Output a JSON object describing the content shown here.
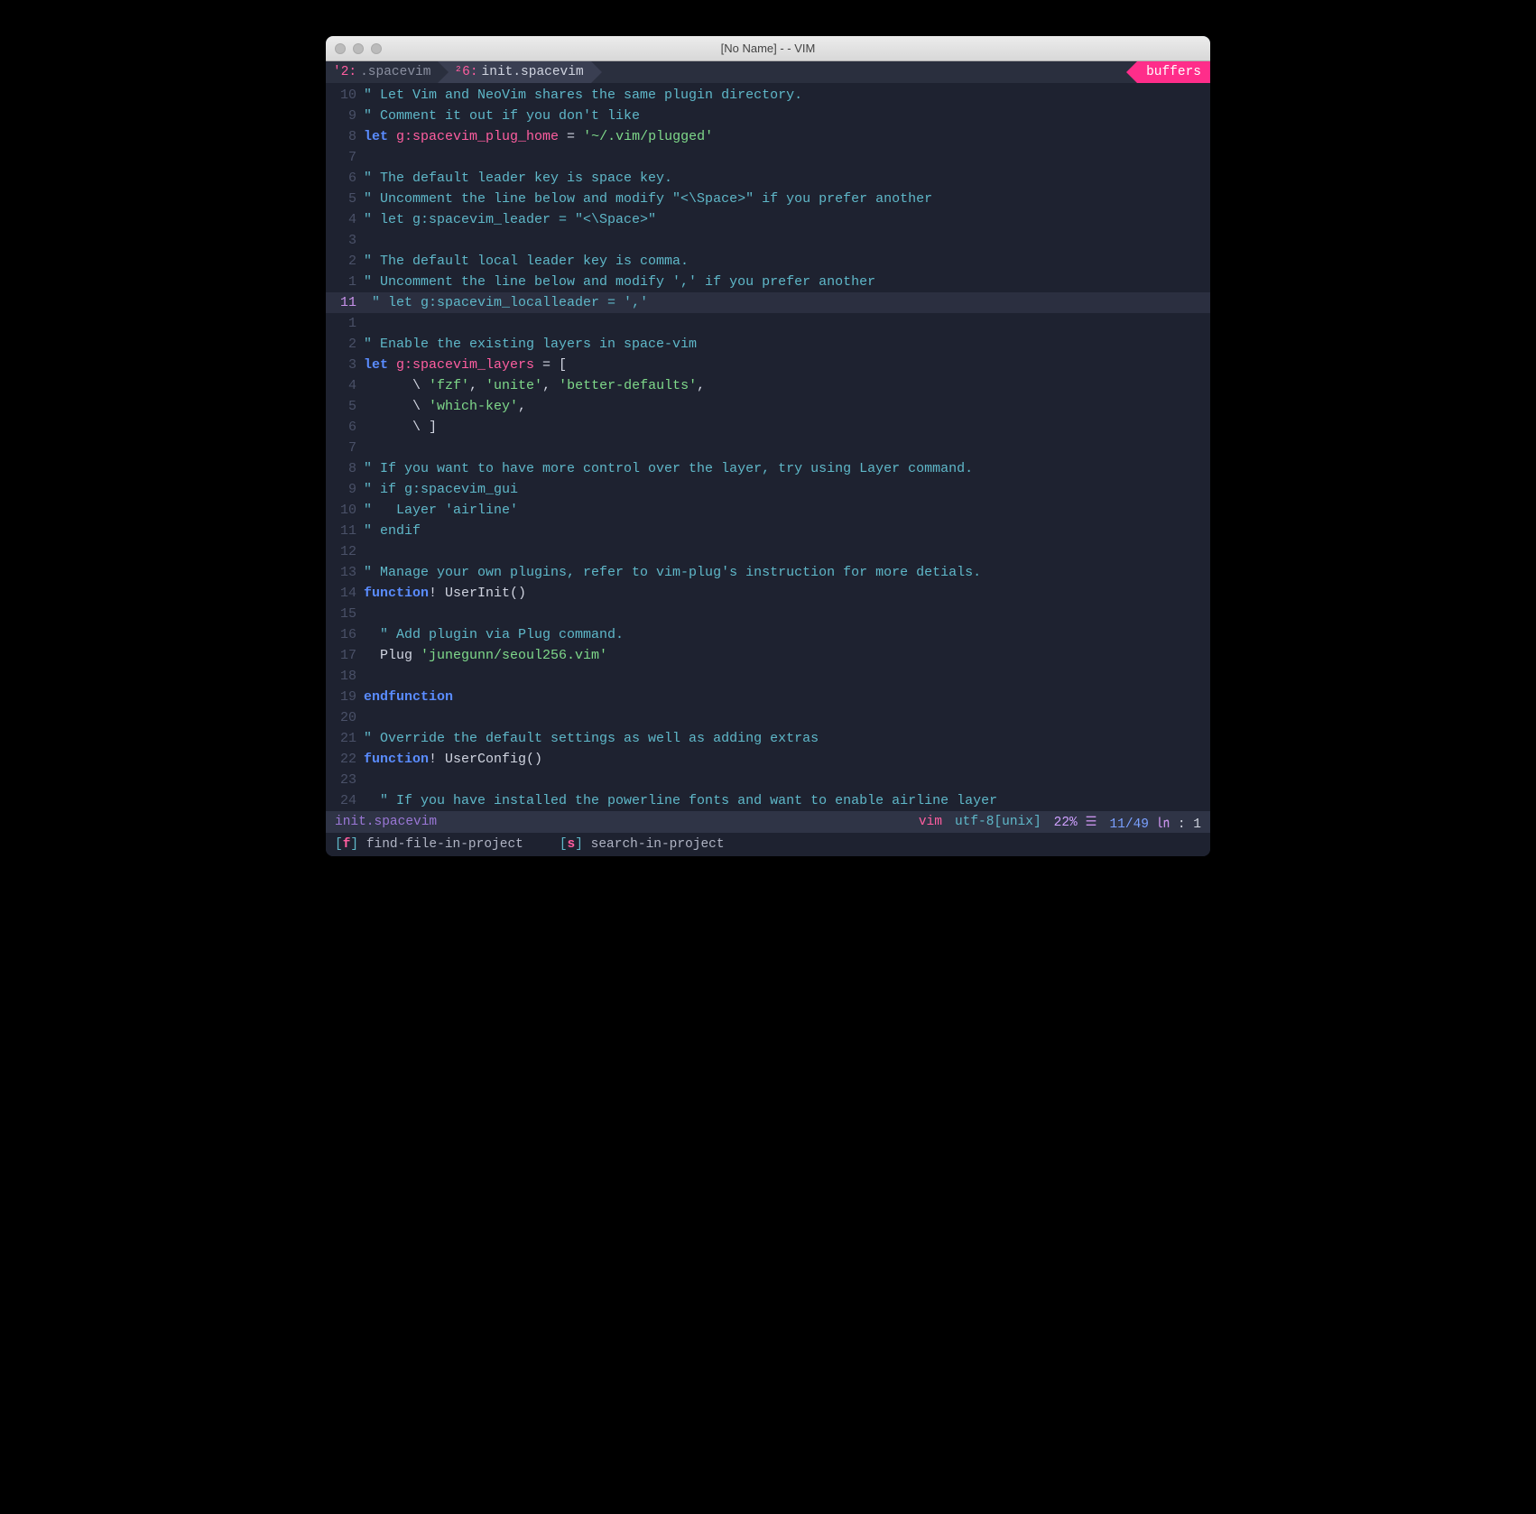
{
  "window": {
    "title": "[No Name] - - VIM"
  },
  "tabline": {
    "tabs": [
      {
        "idx": "'2:",
        "label": ".spacevim"
      },
      {
        "idx": "²6:",
        "label": "init.spacevim"
      }
    ],
    "buffers_label": "buffers"
  },
  "gutter": [
    "10",
    "9",
    "8",
    "7",
    "6",
    "5",
    "4",
    "3",
    "2",
    "1",
    "11",
    "1",
    "2",
    "3",
    "4",
    "5",
    "6",
    "7",
    "8",
    "9",
    "10",
    "11",
    "12",
    "13",
    "14",
    "15",
    "16",
    "17",
    "18",
    "19",
    "20",
    "21",
    "22",
    "23",
    "24"
  ],
  "code": {
    "l0": "\" Let Vim and NeoVim shares the same plugin directory.",
    "l1": "\" Comment it out if you don't like",
    "l2_kw": "let",
    "l2_var": " g:spacevim_plug_home",
    "l2_op": " = ",
    "l2_str": "'~/.vim/plugged'",
    "l3": "",
    "l4": "\" The default leader key is space key.",
    "l5": "\" Uncomment the line below and modify \"<\\Space>\" if you prefer another",
    "l6": "\" let g:spacevim_leader = \"<\\Space>\"",
    "l7": "",
    "l8": "\" The default local leader key is comma.",
    "l9": "\" Uncomment the line below and modify ',' if you prefer another",
    "l10": "\" let g:spacevim_localleader = ','",
    "l11": "",
    "l12": "\" Enable the existing layers in space-vim",
    "l13_kw": "let",
    "l13_var": " g:spacevim_layers",
    "l13_op": " = [",
    "l14_pre": "      \\ ",
    "l14_s1": "'fzf'",
    "l14_c1": ", ",
    "l14_s2": "'unite'",
    "l14_c2": ", ",
    "l14_s3": "'better-defaults'",
    "l14_c3": ",",
    "l15_pre": "      \\ ",
    "l15_s1": "'which-key'",
    "l15_c1": ",",
    "l16": "      \\ ]",
    "l17": "",
    "l18": "\" If you want to have more control over the layer, try using Layer command.",
    "l19": "\" if g:spacevim_gui",
    "l20": "\"   Layer 'airline'",
    "l21": "\" endif",
    "l22": "",
    "l23": "\" Manage your own plugins, refer to vim-plug's instruction for more detials.",
    "l24_kw": "function",
    "l24_bang": "!",
    "l24_name": " UserInit()",
    "l25": "",
    "l26": "  \" Add plugin via Plug command.",
    "l27_pre": "  Plug ",
    "l27_str": "'junegunn/seoul256.vim'",
    "l28": "",
    "l29_kw": "endfunction",
    "l30": "",
    "l31": "\" Override the default settings as well as adding extras",
    "l32_kw": "function",
    "l32_bang": "!",
    "l32_name": " UserConfig()",
    "l33": "",
    "l34": "  \" If you have installed the powerline fonts and want to enable airline layer"
  },
  "status": {
    "file": "init.spacevim",
    "filetype": "vim",
    "encoding": "utf-8[unix]",
    "percent": "22%",
    "hsep": "☰",
    "position": "11/49",
    "rune": "㏑",
    "colsep": ":",
    "col": "1"
  },
  "leader": {
    "f_key": "f",
    "f_label": "find-file-in-project",
    "s_key": "s",
    "s_label": "search-in-project"
  }
}
